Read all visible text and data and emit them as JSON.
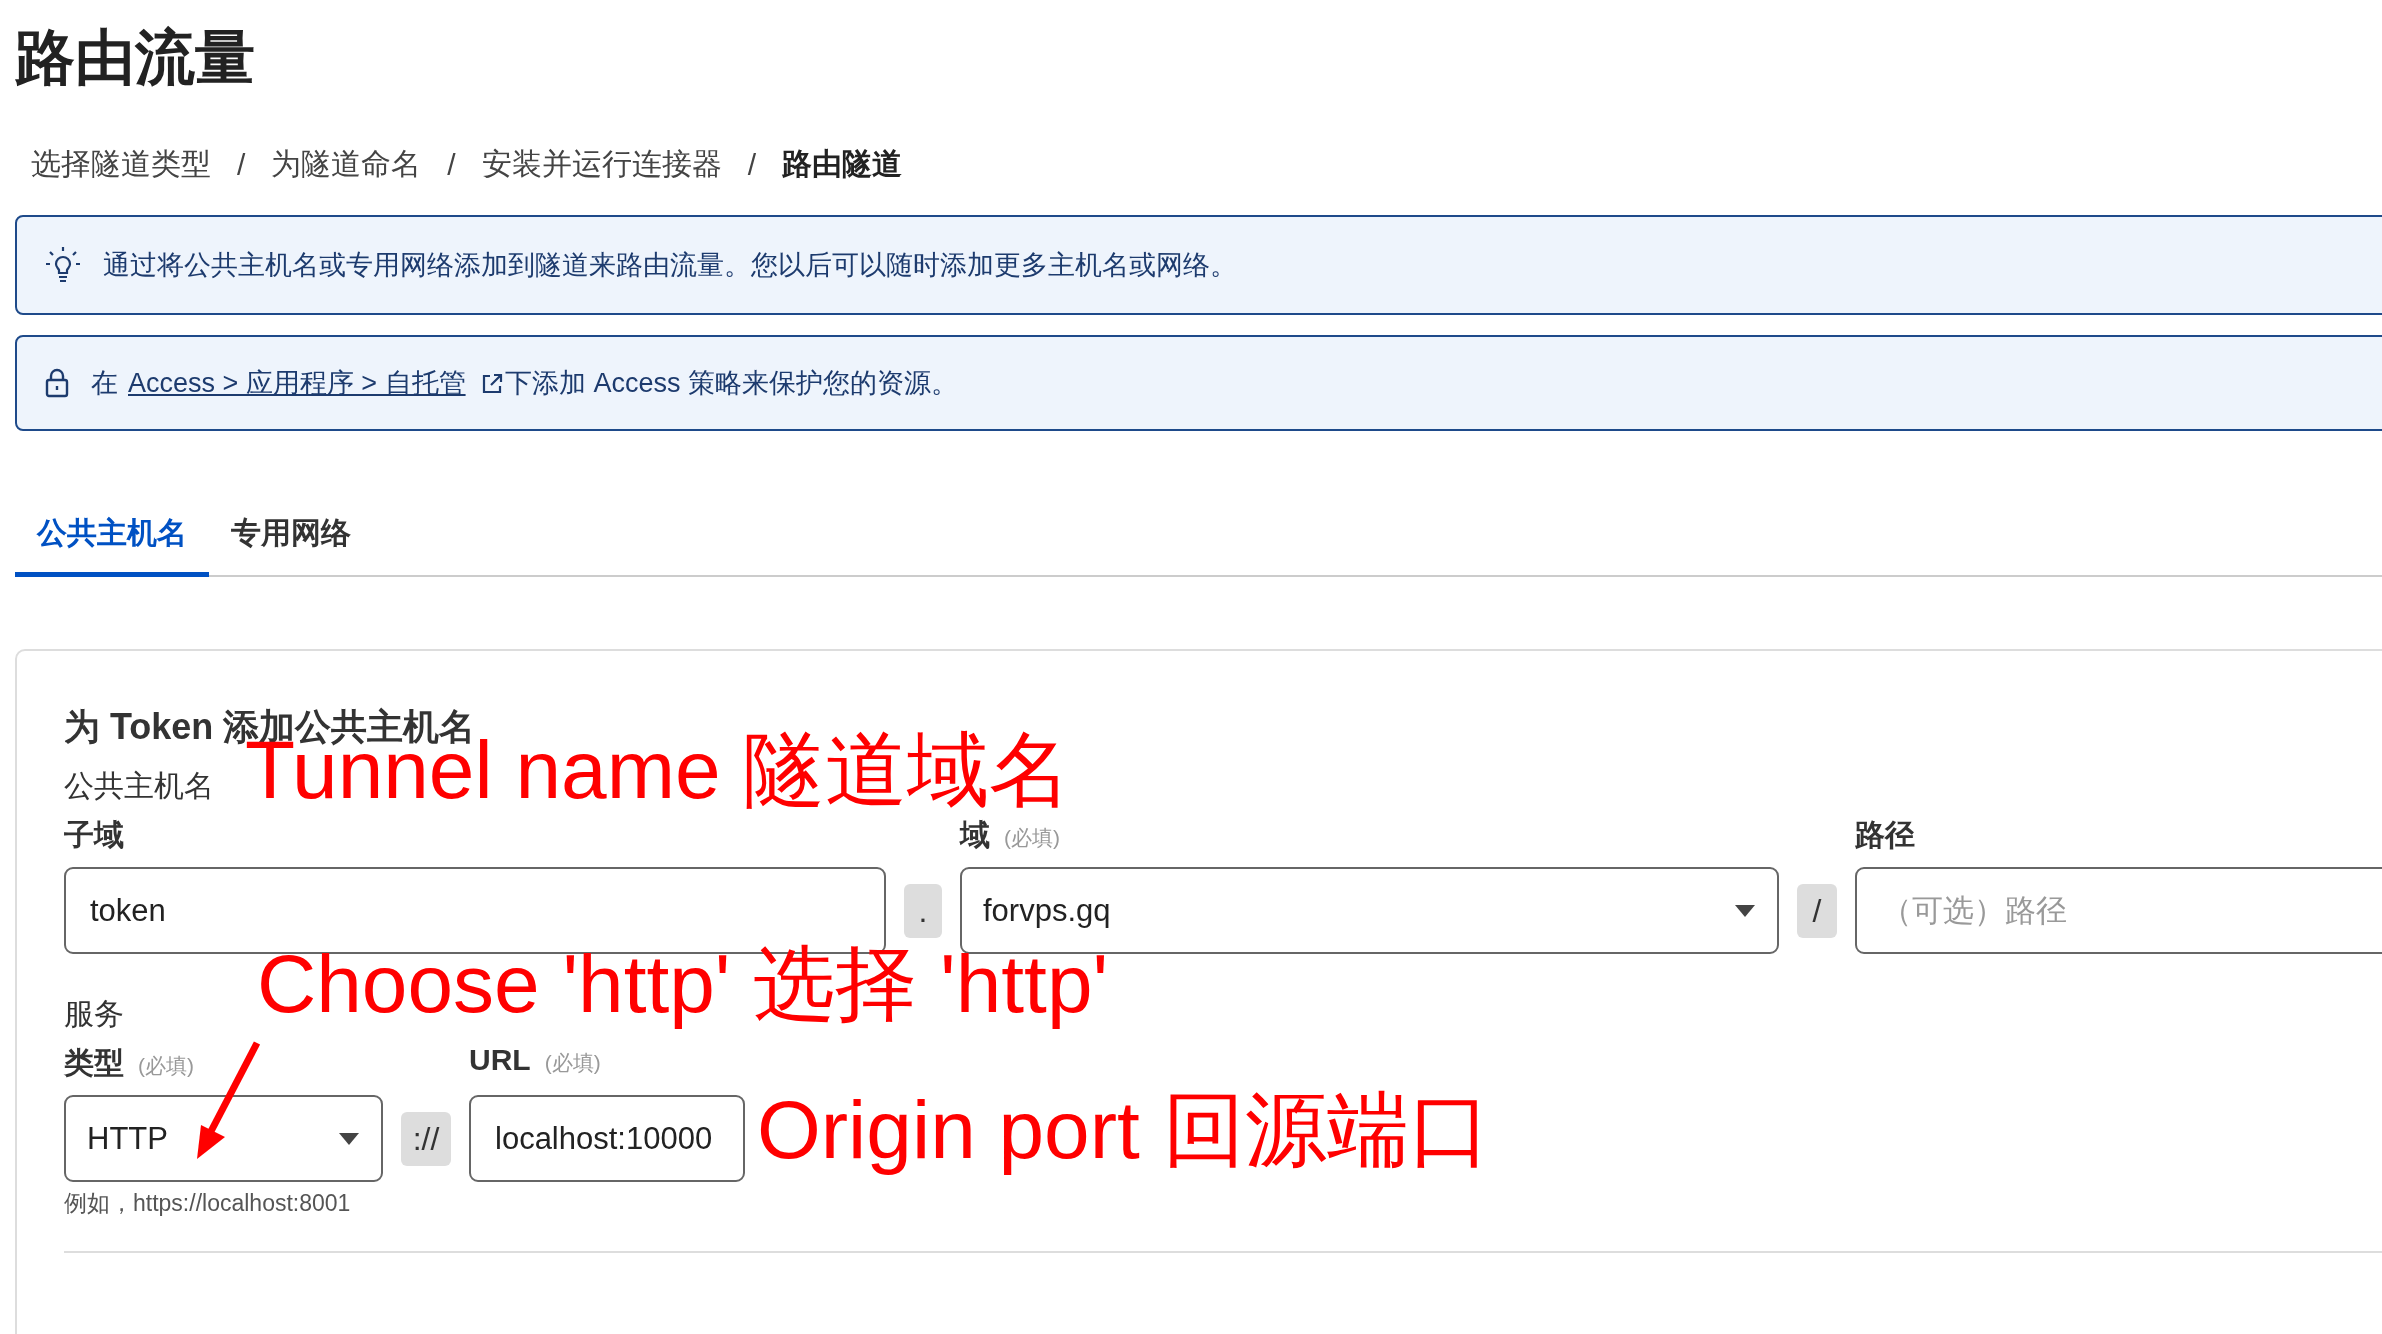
{
  "page_title": "路由流量",
  "breadcrumb": [
    {
      "label": "选择隧道类型",
      "selected": false
    },
    {
      "label": "为隧道命名",
      "selected": false
    },
    {
      "label": "安装并运行连接器",
      "selected": false
    },
    {
      "label": "路由隧道",
      "selected": true
    }
  ],
  "breadcrumb_separators": [
    "/",
    "/",
    "/"
  ],
  "banners": [
    {
      "kind": "tip",
      "text": "通过将公共主机名或专用网络添加到隧道来路由流量。您以后可以随时添加更多主机名或网络。"
    },
    {
      "kind": "lock",
      "before": "在",
      "link": "Access > 应用程序 > 自托管",
      "after": "下添加 Access 策略来保护您的资源。"
    }
  ],
  "tabs": [
    {
      "label": "公共主机名",
      "selected": true
    },
    {
      "label": "专用网络",
      "selected": false
    }
  ],
  "card": {
    "title": "为 Token 添加公共主机名",
    "sections": [
      {
        "heading": "公共主机名",
        "fields": [
          {
            "kind": "input",
            "label": "子域",
            "value": "token"
          },
          {
            "kind": "separator",
            "text": "."
          },
          {
            "kind": "select",
            "label": "域",
            "note": "(必填)",
            "value": "forvps.gq"
          },
          {
            "kind": "separator",
            "text": "/"
          },
          {
            "kind": "input",
            "label": "路径",
            "placeholder": "（可选）路径"
          }
        ]
      },
      {
        "heading": "服务",
        "fields": [
          {
            "kind": "select",
            "label": "类型",
            "note": "(必填)",
            "value": "HTTP"
          },
          {
            "kind": "separator",
            "text": "://"
          },
          {
            "kind": "input",
            "label": "URL",
            "note": "(必填)",
            "value": "localhost:10000"
          }
        ],
        "helper": "例如，https://localhost:8001"
      }
    ]
  },
  "annotations": [
    {
      "text": "Tunnel name 隧道域名"
    },
    {
      "text": "Choose 'http' 选择 'http'"
    },
    {
      "text": "Origin port 回源端口"
    }
  ]
}
